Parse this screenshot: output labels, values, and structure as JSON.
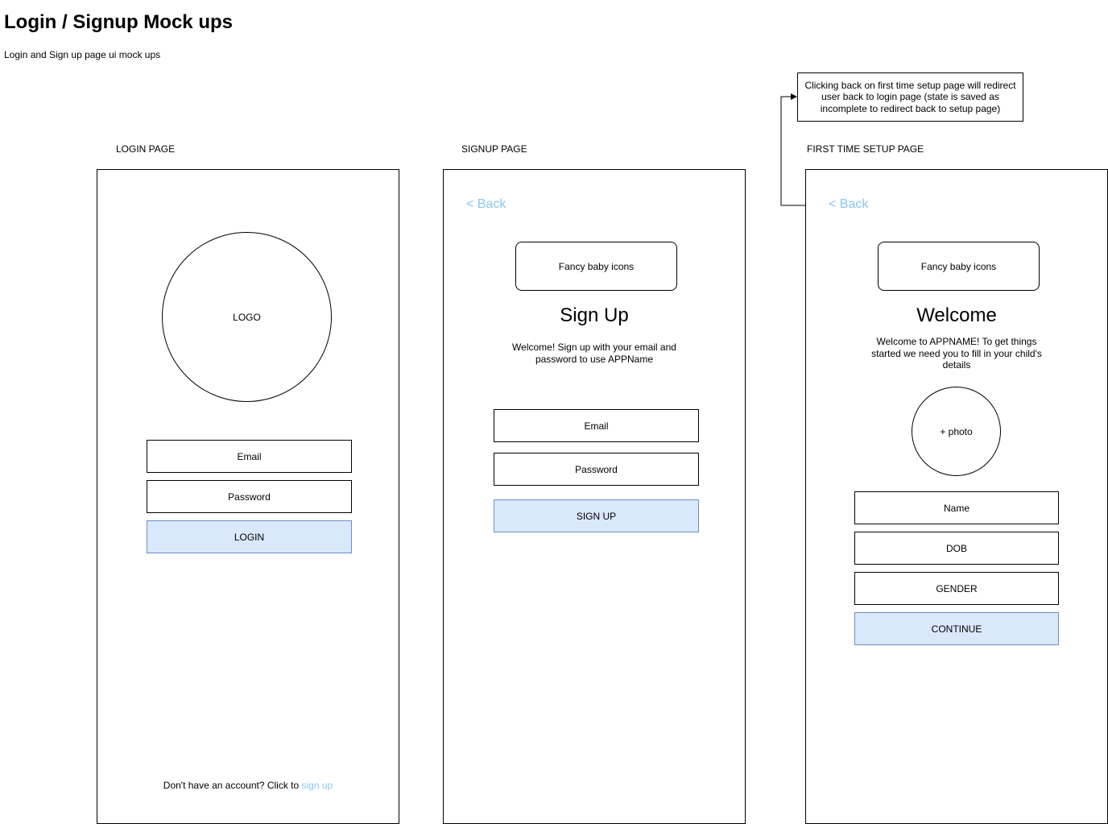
{
  "doc": {
    "title": "Login / Signup Mock ups",
    "subtitle": "Login and Sign up page ui mock ups"
  },
  "note": "Clicking back on first time setup page will redirect user back to login page (state is saved as incomplete to redirect back to setup page)",
  "login": {
    "label": "LOGIN PAGE",
    "logo": "LOGO",
    "email": "Email",
    "password": "Password",
    "button": "LOGIN",
    "footer_text": "Don't have an account? Click to ",
    "footer_link": "sign up"
  },
  "signup": {
    "label": "SIGNUP PAGE",
    "back": "< Back",
    "icons": "Fancy baby icons",
    "heading": "Sign Up",
    "description": "Welcome! Sign up with your email and password to use APPName",
    "email": "Email",
    "password": "Password",
    "button": "SIGN UP"
  },
  "setup": {
    "label": "FIRST TIME SETUP PAGE",
    "back": "< Back",
    "icons": "Fancy baby icons",
    "heading": "Welcome",
    "description": "Welcome to APPNAME! To get things started we need you to fill in your child's details",
    "photo": "+ photo",
    "name": "Name",
    "dob": "DOB",
    "gender": "GENDER",
    "button": "CONTINUE"
  }
}
